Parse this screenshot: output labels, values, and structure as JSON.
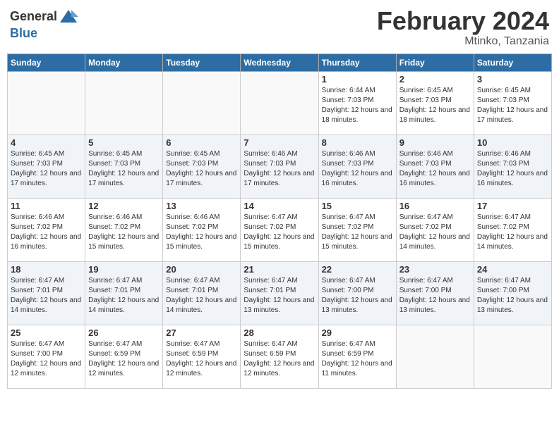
{
  "header": {
    "logo_general": "General",
    "logo_blue": "Blue",
    "month_title": "February 2024",
    "location": "Mtinko, Tanzania"
  },
  "weekdays": [
    "Sunday",
    "Monday",
    "Tuesday",
    "Wednesday",
    "Thursday",
    "Friday",
    "Saturday"
  ],
  "weeks": [
    [
      {
        "day": "",
        "info": ""
      },
      {
        "day": "",
        "info": ""
      },
      {
        "day": "",
        "info": ""
      },
      {
        "day": "",
        "info": ""
      },
      {
        "day": "1",
        "info": "Sunrise: 6:44 AM\nSunset: 7:03 PM\nDaylight: 12 hours and 18 minutes."
      },
      {
        "day": "2",
        "info": "Sunrise: 6:45 AM\nSunset: 7:03 PM\nDaylight: 12 hours and 18 minutes."
      },
      {
        "day": "3",
        "info": "Sunrise: 6:45 AM\nSunset: 7:03 PM\nDaylight: 12 hours and 17 minutes."
      }
    ],
    [
      {
        "day": "4",
        "info": "Sunrise: 6:45 AM\nSunset: 7:03 PM\nDaylight: 12 hours and 17 minutes."
      },
      {
        "day": "5",
        "info": "Sunrise: 6:45 AM\nSunset: 7:03 PM\nDaylight: 12 hours and 17 minutes."
      },
      {
        "day": "6",
        "info": "Sunrise: 6:45 AM\nSunset: 7:03 PM\nDaylight: 12 hours and 17 minutes."
      },
      {
        "day": "7",
        "info": "Sunrise: 6:46 AM\nSunset: 7:03 PM\nDaylight: 12 hours and 17 minutes."
      },
      {
        "day": "8",
        "info": "Sunrise: 6:46 AM\nSunset: 7:03 PM\nDaylight: 12 hours and 16 minutes."
      },
      {
        "day": "9",
        "info": "Sunrise: 6:46 AM\nSunset: 7:03 PM\nDaylight: 12 hours and 16 minutes."
      },
      {
        "day": "10",
        "info": "Sunrise: 6:46 AM\nSunset: 7:03 PM\nDaylight: 12 hours and 16 minutes."
      }
    ],
    [
      {
        "day": "11",
        "info": "Sunrise: 6:46 AM\nSunset: 7:02 PM\nDaylight: 12 hours and 16 minutes."
      },
      {
        "day": "12",
        "info": "Sunrise: 6:46 AM\nSunset: 7:02 PM\nDaylight: 12 hours and 15 minutes."
      },
      {
        "day": "13",
        "info": "Sunrise: 6:46 AM\nSunset: 7:02 PM\nDaylight: 12 hours and 15 minutes."
      },
      {
        "day": "14",
        "info": "Sunrise: 6:47 AM\nSunset: 7:02 PM\nDaylight: 12 hours and 15 minutes."
      },
      {
        "day": "15",
        "info": "Sunrise: 6:47 AM\nSunset: 7:02 PM\nDaylight: 12 hours and 15 minutes."
      },
      {
        "day": "16",
        "info": "Sunrise: 6:47 AM\nSunset: 7:02 PM\nDaylight: 12 hours and 14 minutes."
      },
      {
        "day": "17",
        "info": "Sunrise: 6:47 AM\nSunset: 7:02 PM\nDaylight: 12 hours and 14 minutes."
      }
    ],
    [
      {
        "day": "18",
        "info": "Sunrise: 6:47 AM\nSunset: 7:01 PM\nDaylight: 12 hours and 14 minutes."
      },
      {
        "day": "19",
        "info": "Sunrise: 6:47 AM\nSunset: 7:01 PM\nDaylight: 12 hours and 14 minutes."
      },
      {
        "day": "20",
        "info": "Sunrise: 6:47 AM\nSunset: 7:01 PM\nDaylight: 12 hours and 14 minutes."
      },
      {
        "day": "21",
        "info": "Sunrise: 6:47 AM\nSunset: 7:01 PM\nDaylight: 12 hours and 13 minutes."
      },
      {
        "day": "22",
        "info": "Sunrise: 6:47 AM\nSunset: 7:00 PM\nDaylight: 12 hours and 13 minutes."
      },
      {
        "day": "23",
        "info": "Sunrise: 6:47 AM\nSunset: 7:00 PM\nDaylight: 12 hours and 13 minutes."
      },
      {
        "day": "24",
        "info": "Sunrise: 6:47 AM\nSunset: 7:00 PM\nDaylight: 12 hours and 13 minutes."
      }
    ],
    [
      {
        "day": "25",
        "info": "Sunrise: 6:47 AM\nSunset: 7:00 PM\nDaylight: 12 hours and 12 minutes."
      },
      {
        "day": "26",
        "info": "Sunrise: 6:47 AM\nSunset: 6:59 PM\nDaylight: 12 hours and 12 minutes."
      },
      {
        "day": "27",
        "info": "Sunrise: 6:47 AM\nSunset: 6:59 PM\nDaylight: 12 hours and 12 minutes."
      },
      {
        "day": "28",
        "info": "Sunrise: 6:47 AM\nSunset: 6:59 PM\nDaylight: 12 hours and 12 minutes."
      },
      {
        "day": "29",
        "info": "Sunrise: 6:47 AM\nSunset: 6:59 PM\nDaylight: 12 hours and 11 minutes."
      },
      {
        "day": "",
        "info": ""
      },
      {
        "day": "",
        "info": ""
      }
    ]
  ]
}
